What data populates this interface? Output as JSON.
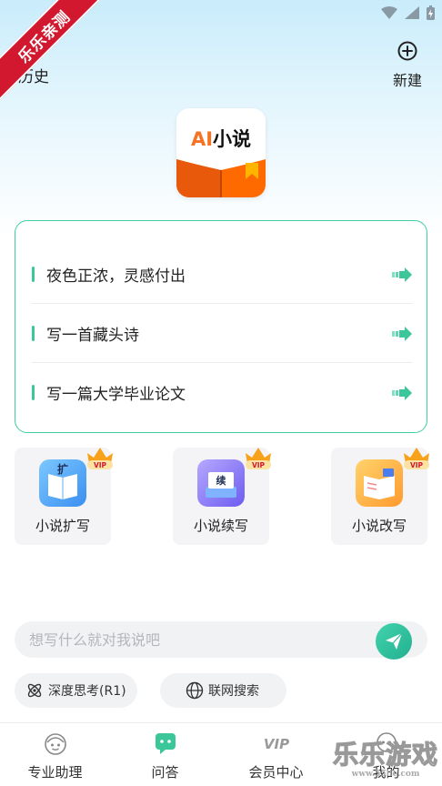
{
  "watermark_ribbon": "乐乐亲测",
  "header": {
    "history_label": "历史",
    "new_label": "新建"
  },
  "logo": {
    "ai_text": "AI",
    "title_text": "小说"
  },
  "prompts": [
    {
      "text": "夜色正浓，灵感付出"
    },
    {
      "text": "写一首藏头诗"
    },
    {
      "text": "写一篇大学毕业论文"
    }
  ],
  "features": [
    {
      "label": "小说扩写",
      "icon": "book-expand-icon",
      "badge": "VIP"
    },
    {
      "label": "小说续写",
      "icon": "book-continue-icon",
      "badge": "VIP"
    },
    {
      "label": "小说改写",
      "icon": "book-rewrite-icon",
      "badge": "VIP"
    }
  ],
  "input": {
    "placeholder": "想写什么就对我说吧",
    "value": ""
  },
  "chips": {
    "deep_think": "深度思考(R1)",
    "web_search": "联网搜索"
  },
  "tabs": [
    {
      "label": "专业助理",
      "icon": "assistant-icon"
    },
    {
      "label": "问答",
      "icon": "chat-icon",
      "active": true
    },
    {
      "label": "会员中心",
      "icon": "vip-icon"
    },
    {
      "label": "我的",
      "icon": "profile-icon"
    }
  ],
  "corner_watermark": {
    "title": "乐乐游戏",
    "url": "www.55lle.com"
  },
  "colors": {
    "accent": "#3cc79a",
    "brand_orange": "#f57322",
    "ribbon": "#d2182e"
  }
}
